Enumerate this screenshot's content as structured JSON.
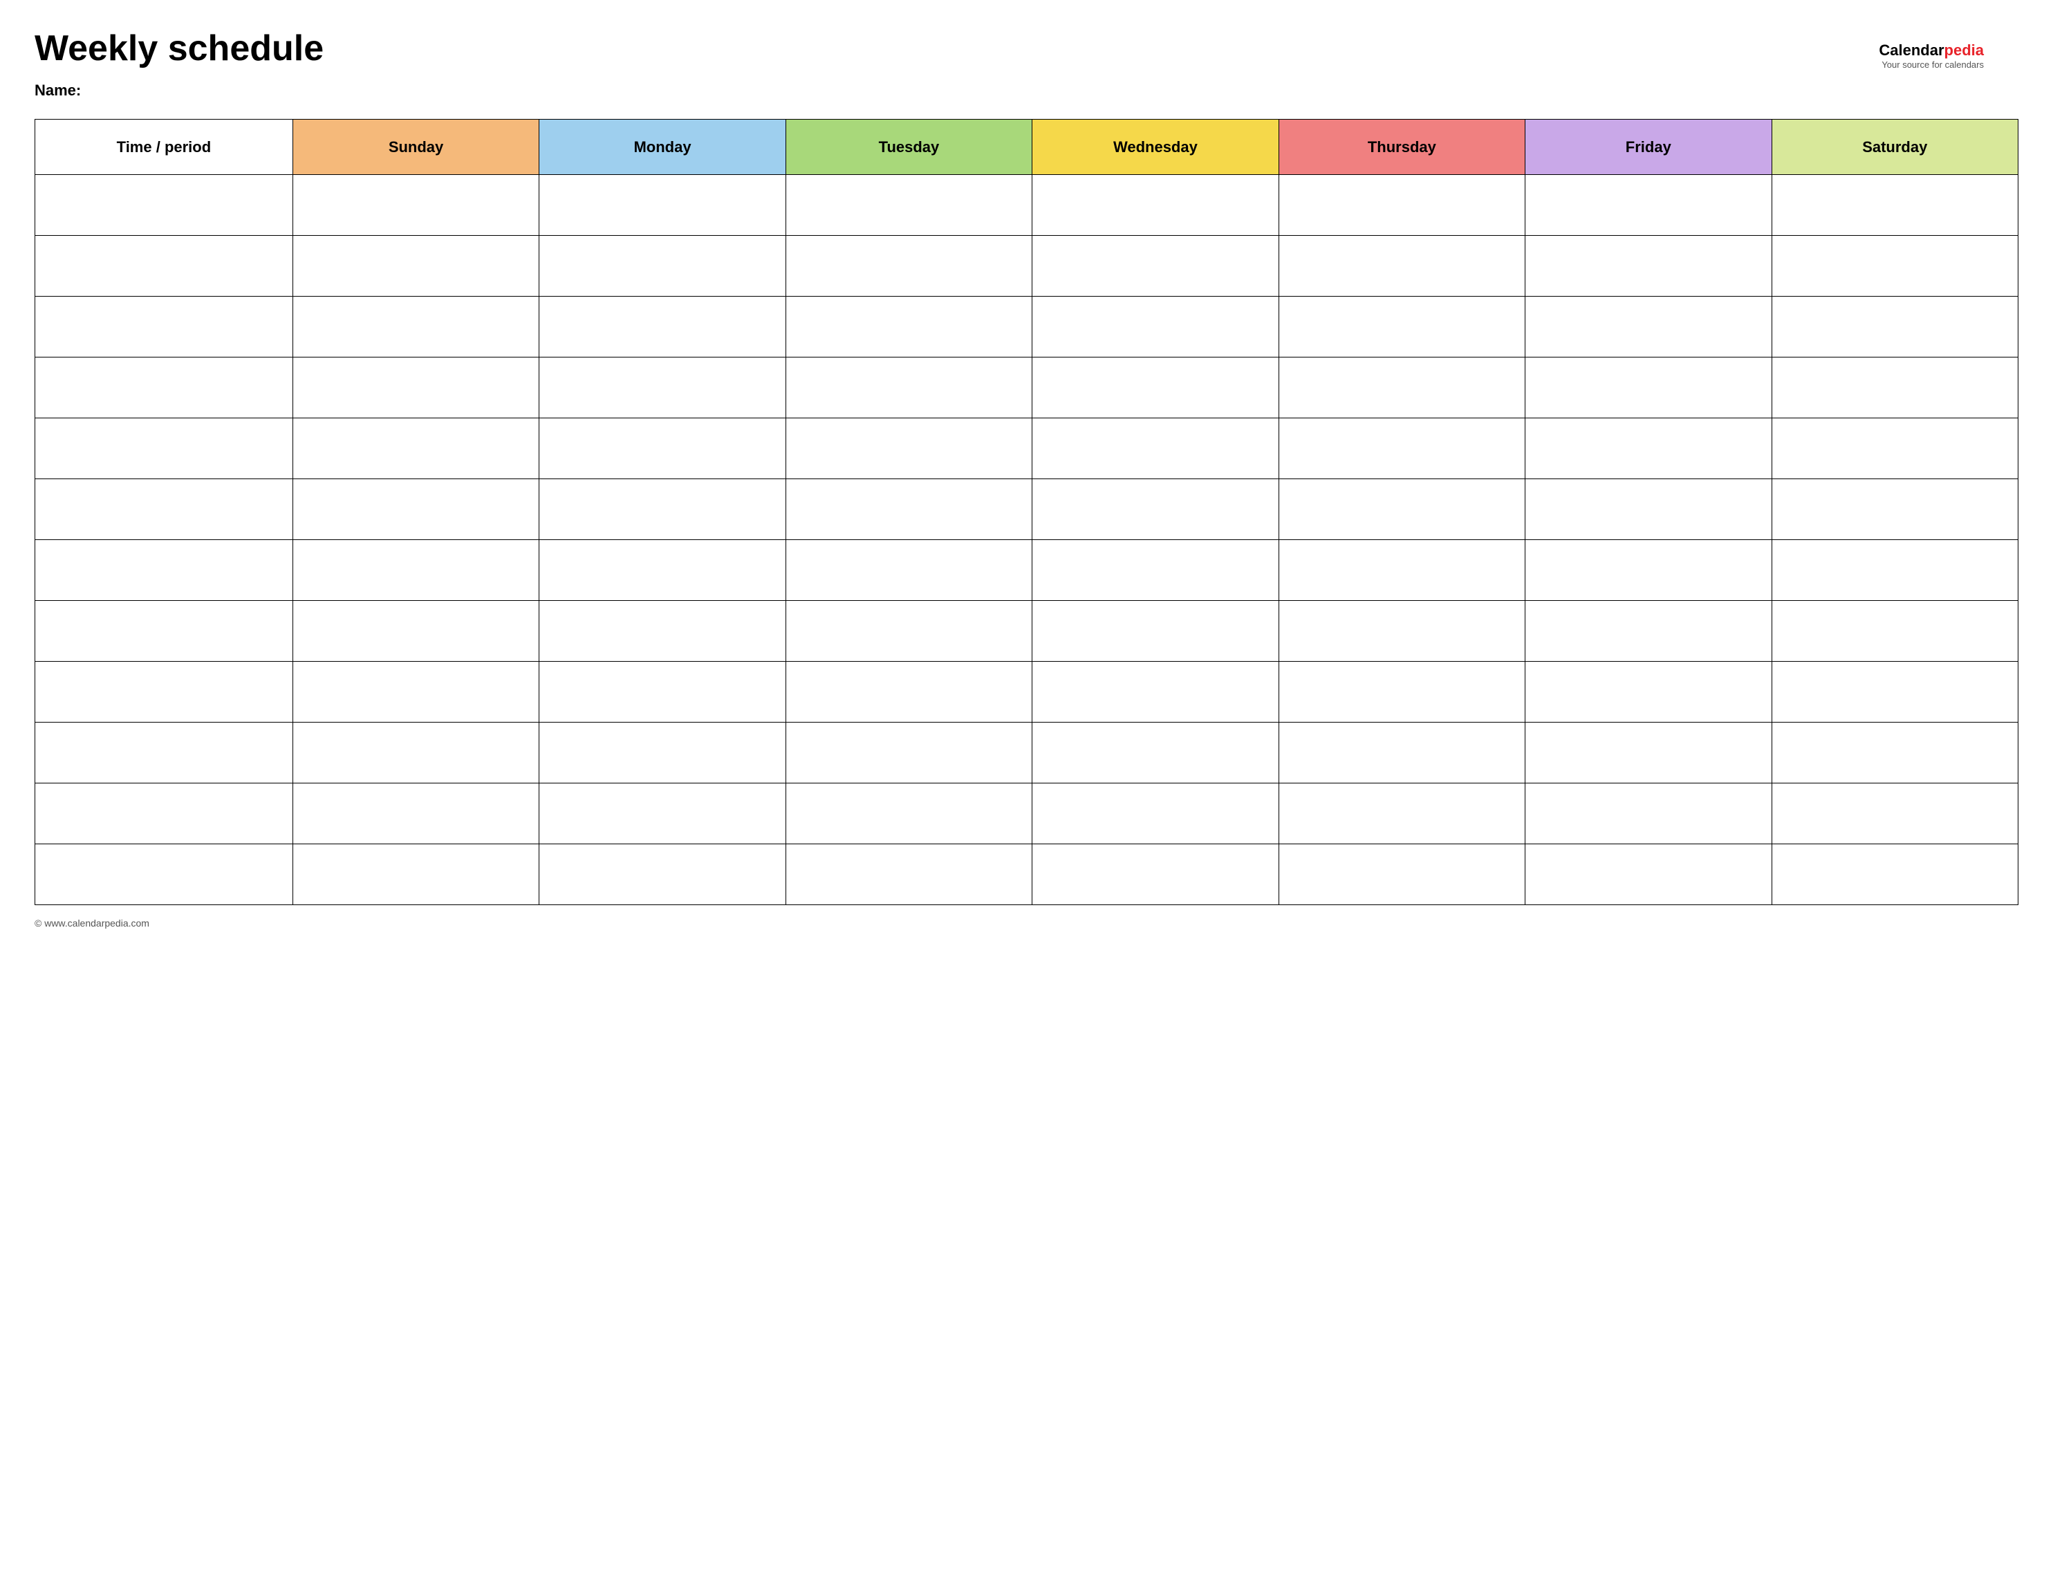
{
  "page": {
    "title": "Weekly schedule",
    "name_label": "Name:",
    "footer": "© www.calendarpedia.com"
  },
  "logo": {
    "brand_part1": "Calendar",
    "brand_part2": "pedia",
    "tagline": "Your source for calendars"
  },
  "table": {
    "time_period_label": "Time / period",
    "days": [
      {
        "label": "Sunday",
        "color_class": "col-sunday"
      },
      {
        "label": "Monday",
        "color_class": "col-monday"
      },
      {
        "label": "Tuesday",
        "color_class": "col-tuesday"
      },
      {
        "label": "Wednesday",
        "color_class": "col-wednesday"
      },
      {
        "label": "Thursday",
        "color_class": "col-thursday"
      },
      {
        "label": "Friday",
        "color_class": "col-friday"
      },
      {
        "label": "Saturday",
        "color_class": "col-saturday"
      }
    ],
    "row_count": 12
  }
}
